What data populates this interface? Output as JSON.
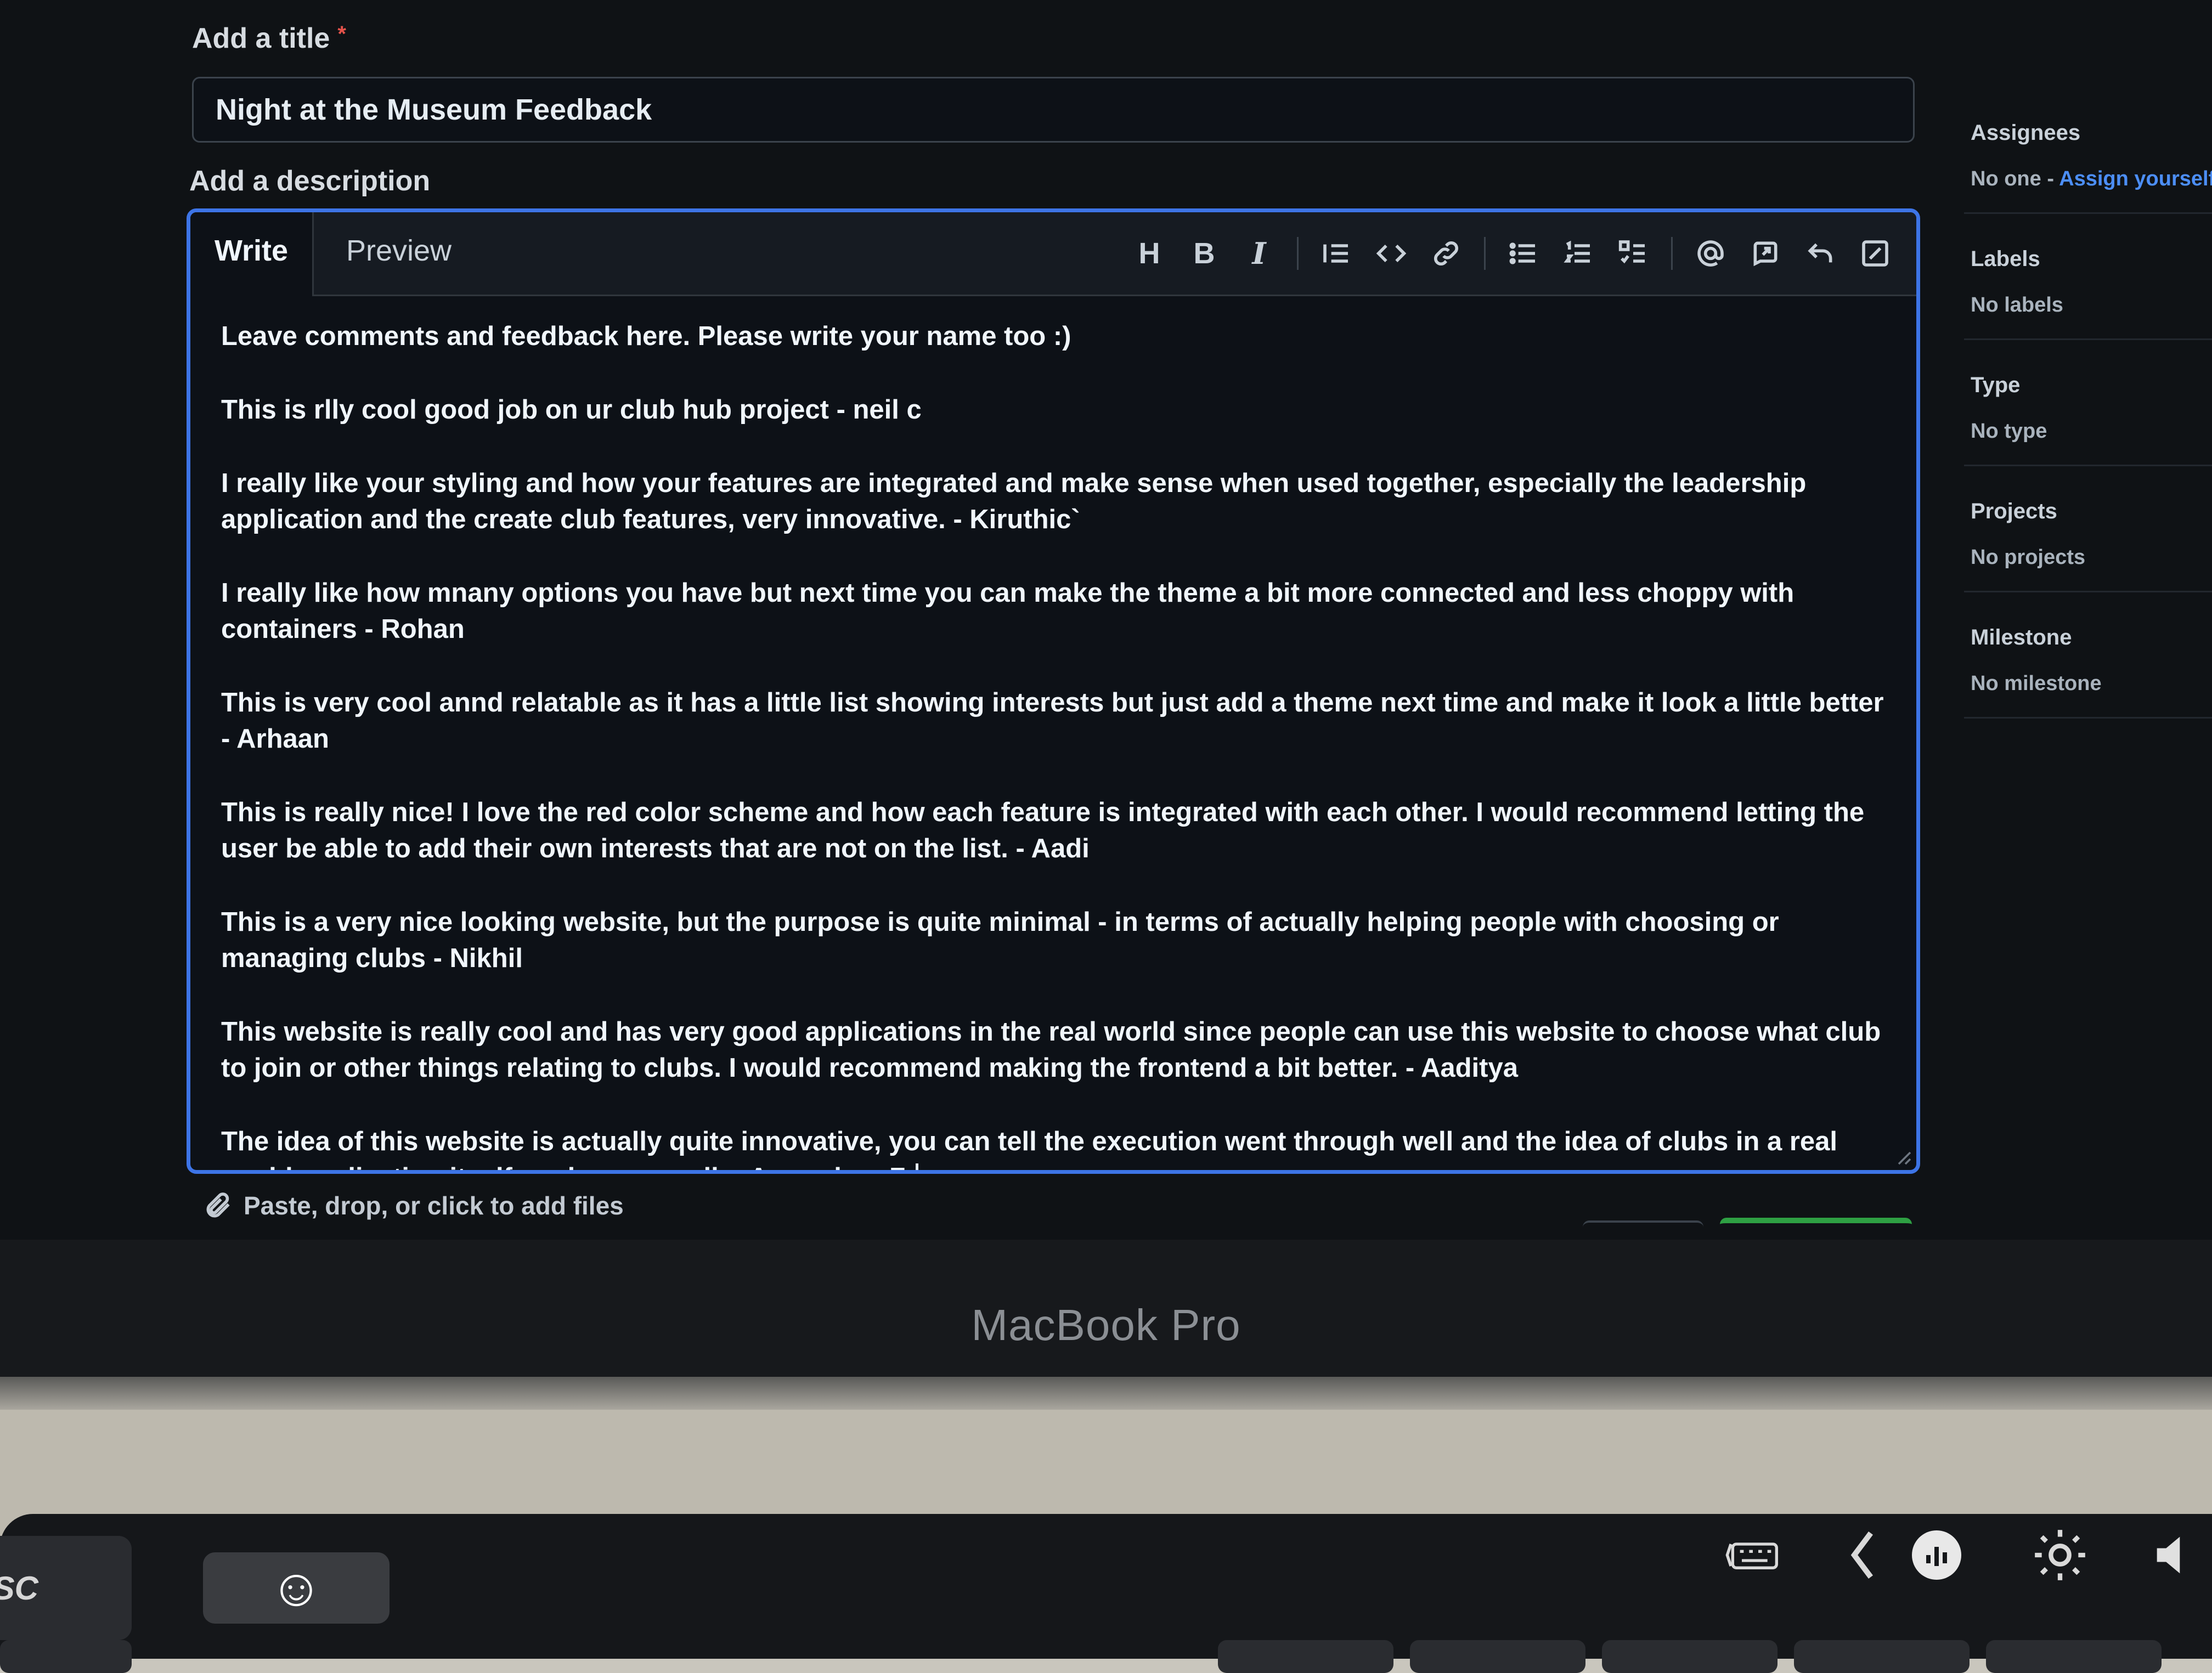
{
  "form": {
    "title_label": "Add a title",
    "required_marker": "*",
    "title_value": "Night at the Museum Feedback",
    "description_label": "Add a description"
  },
  "editor": {
    "tabs": {
      "write": "Write",
      "preview": "Preview"
    },
    "toolbar": [
      {
        "name": "heading-icon",
        "glyph": "H"
      },
      {
        "name": "bold-icon",
        "glyph": "B"
      },
      {
        "name": "italic-icon",
        "glyph": "I"
      },
      {
        "name": "quote-icon"
      },
      {
        "name": "code-icon"
      },
      {
        "name": "link-icon"
      },
      {
        "name": "unordered-list-icon"
      },
      {
        "name": "ordered-list-icon"
      },
      {
        "name": "task-list-icon"
      },
      {
        "name": "mention-icon"
      },
      {
        "name": "reference-icon"
      },
      {
        "name": "undo-icon"
      },
      {
        "name": "fullscreen-icon"
      }
    ],
    "paragraphs": [
      "Leave comments and feedback here. Please write your name too :)",
      "This is rlly cool good job on ur club hub project - neil c",
      "I really like your styling and how your features are integrated and make sense when used together, especially the leadership application and the create club features, very innovative. - Kiruthic`",
      "I really like how mnany options you have but next time you can make the theme a bit more connected and less choppy with containers - Rohan",
      "This is very cool annd relatable as it has a little list showing interests but just add a theme next time and make it look a little better - Arhaan",
      "This is really nice! I love the red color scheme and how each feature is integrated with each other. I would recommend letting the user be able to add their own interests that are not on the list. - Aadi",
      "This is a very nice looking website, but the purpose is quite minimal - in terms of actually helping people with choosing or managing clubs - Nikhil",
      "This website is really cool and has very good applications in the real world since people can use this website to choose what club to join or other things relating to clubs. I would recommend making the frontend a bit better. - Aaditya",
      "The idea of this website is actually quite innovative, you can tell the execution went through well and the idea of clubs in a real world application itself works very well. - Armaghan Z."
    ],
    "attach_text": "Paste, drop, or click to add files"
  },
  "sidebar": {
    "assignees": {
      "heading": "Assignees",
      "value": "No one - ",
      "link": "Assign yourself"
    },
    "labels": {
      "heading": "Labels",
      "value": "No labels"
    },
    "type": {
      "heading": "Type",
      "value": "No type"
    },
    "projects": {
      "heading": "Projects",
      "value": "No projects"
    },
    "milestone": {
      "heading": "Milestone",
      "value": "No milestone"
    }
  },
  "laptop": {
    "brand": "MacBook Pro",
    "esc_key": "SC"
  },
  "colors": {
    "accent_blue": "#3d74e6",
    "link_blue": "#4c8ef7",
    "submit_green": "#2ea043",
    "required_red": "#e5534b",
    "screen_bg": "#0d1117"
  }
}
